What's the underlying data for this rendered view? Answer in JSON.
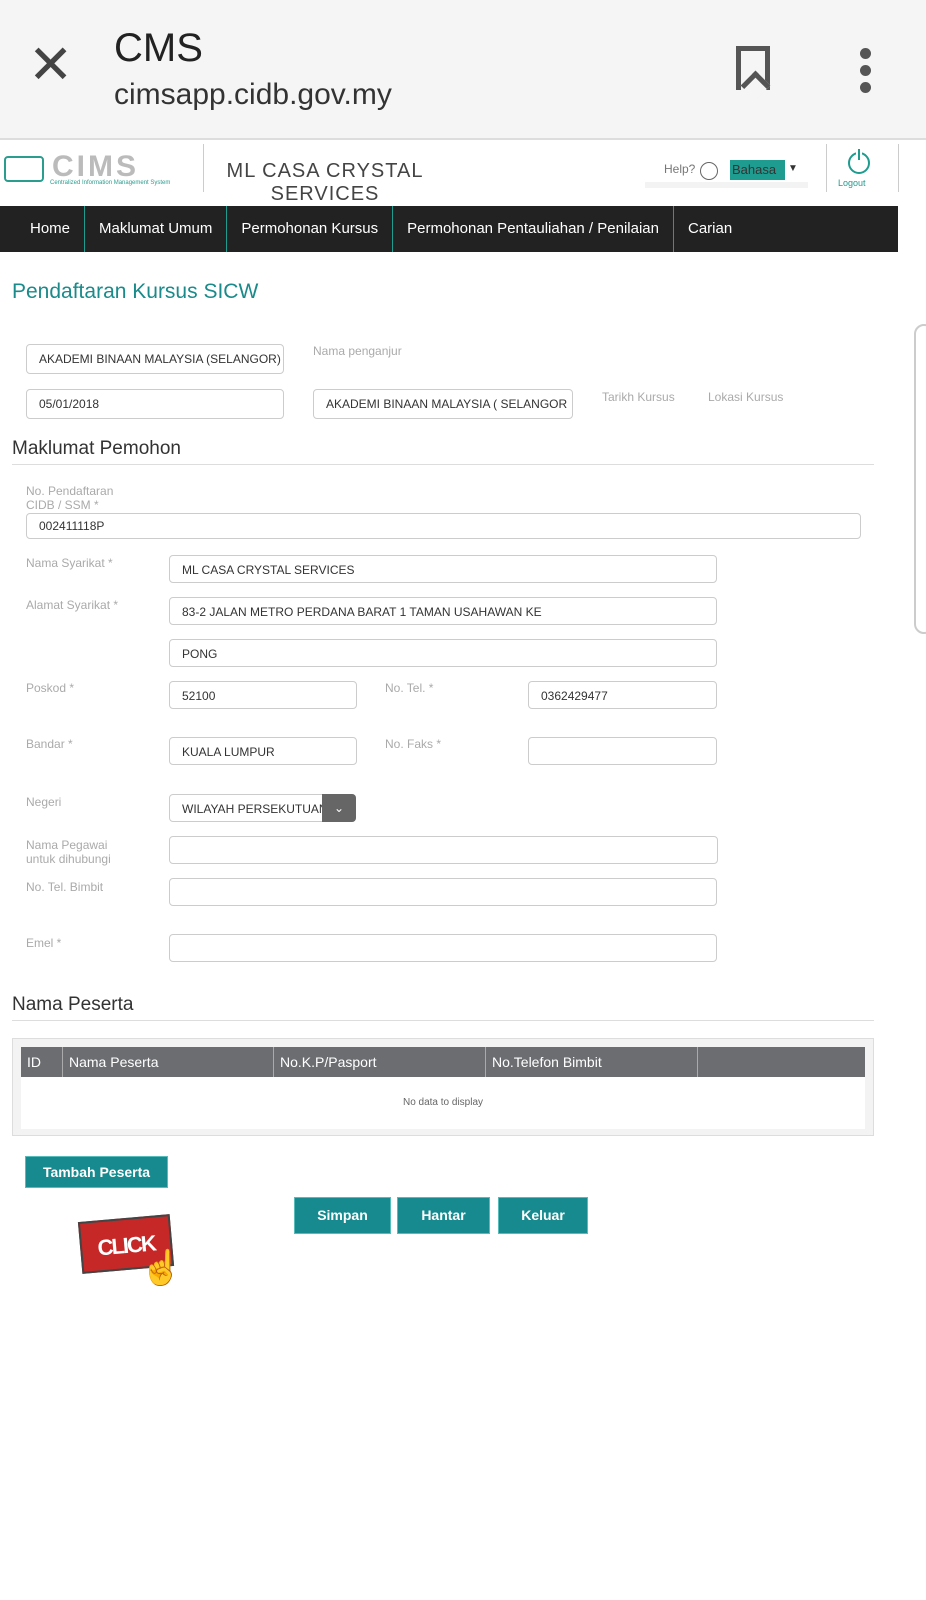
{
  "browser": {
    "title": "CMS",
    "url": "cimsapp.cidb.gov.my",
    "close_icon": "close-icon",
    "bookmark_icon": "bookmark-icon",
    "menu_icon": "more-vert-icon"
  },
  "header": {
    "logo_text": "CIMS",
    "logo_subtitle": "Centralized Information Management System",
    "company": "ML CASA CRYSTAL SERVICES",
    "help": "Help?",
    "language": "Bahasa",
    "logout": "Logout",
    "accent": "#1e9c8f"
  },
  "nav": [
    "Home",
    "Maklumat Umum",
    "Permohonan Kursus",
    "Permohonan Pentauliahan / Penilaian",
    "Carian"
  ],
  "page_title": "Pendaftaran Kursus SICW",
  "course": {
    "organizer_value": "AKADEMI BINAAN MALAYSIA (SELANGOR)",
    "organizer_label": "Nama penganjur",
    "date_value": "05/01/2018",
    "location_value": "AKADEMI BINAAN MALAYSIA ( SELANGOR",
    "date_label": "Tarikh Kursus",
    "location_label": "Lokasi Kursus"
  },
  "applicant": {
    "section": "Maklumat Pemohon",
    "reg_label": "No. Pendaftaran CIDB / SSM *",
    "reg_value": "002411118P",
    "company_label": "Nama Syarikat *",
    "company_value": "ML CASA CRYSTAL SERVICES",
    "address_label": "Alamat Syarikat *",
    "address1": "83-2 JALAN METRO PERDANA BARAT 1 TAMAN USAHAWAN KE",
    "address2": "PONG",
    "postcode_label": "Poskod *",
    "postcode_value": "52100",
    "tel_label": "No. Tel. *",
    "tel_value": "0362429477",
    "city_label": "Bandar *",
    "city_value": "KUALA LUMPUR",
    "fax_label": "No. Faks *",
    "fax_value": "",
    "state_label": "Negeri",
    "state_value": "WILAYAH PERSEKUTUAN",
    "contact_label": "Nama Pegawai untuk dihubungi",
    "contact_value": "",
    "mobile_label": "No. Tel. Bimbit",
    "mobile_value": "",
    "email_label": "Emel *",
    "email_value": ""
  },
  "participants": {
    "section": "Nama Peserta",
    "columns": [
      "ID",
      "Nama Peserta",
      "No.K.P/Pasport",
      "No.Telefon Bimbit",
      ""
    ],
    "empty": "No data to display",
    "add_button": "Tambah Peserta"
  },
  "actions": {
    "save": "Simpan",
    "submit": "Hantar",
    "exit": "Keluar"
  },
  "click_here": "CLICK HERE"
}
